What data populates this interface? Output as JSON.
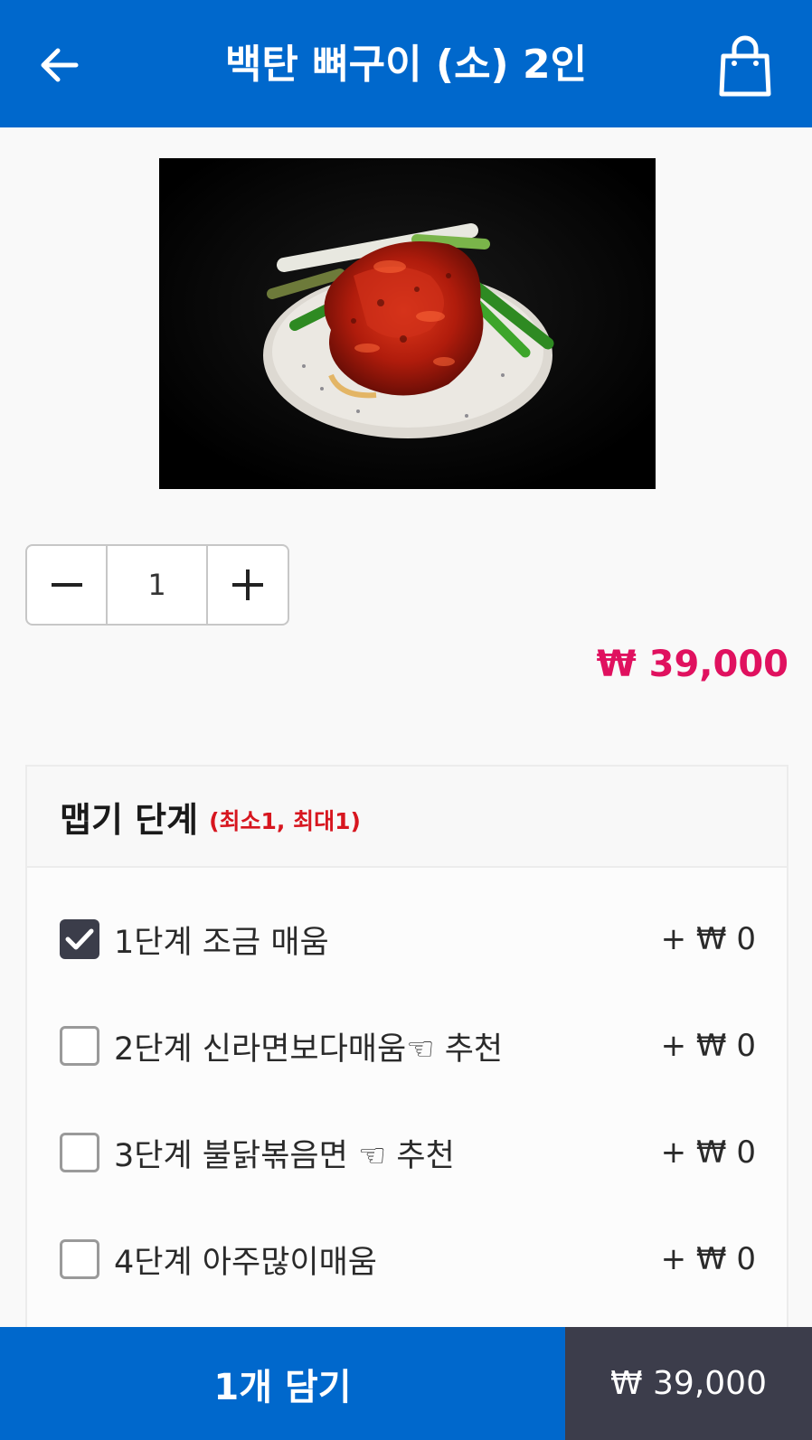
{
  "header": {
    "title": "백탄 뼈구이 (소) 2인",
    "back_icon": "arrow-left-icon",
    "cart_icon": "shopping-bag-icon",
    "bg_color": "#0068cc"
  },
  "product": {
    "image_icon": "food-photo"
  },
  "quantity": {
    "minus_icon": "minus-icon",
    "value": "1",
    "plus_icon": "plus-icon"
  },
  "price": "₩ 39,000",
  "option_group": {
    "title": "맵기 단계",
    "limit": "(최소1, 최대1)",
    "options": [
      {
        "label": "1단계 조금 매움",
        "extra": "+ ₩ 0",
        "checked": true
      },
      {
        "label": "2단계 신라면보다매움☜ 추천",
        "extra": "+ ₩ 0",
        "checked": false
      },
      {
        "label": "3단계 불닭볶음면 ☜ 추천",
        "extra": "+ ₩ 0",
        "checked": false
      },
      {
        "label": "4단계 아주많이매움",
        "extra": "+ ₩ 0",
        "checked": false
      }
    ]
  },
  "footer": {
    "add_label": "1개 담기",
    "total": "₩ 39,000"
  },
  "colors": {
    "brand_blue": "#0068cc",
    "price_pink": "#e0115f",
    "limit_red": "#d7161f",
    "footer_dark": "#3c3d4b",
    "checkbox_on": "#3b3d4a"
  }
}
